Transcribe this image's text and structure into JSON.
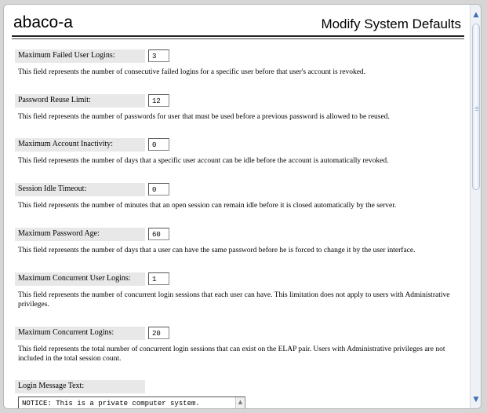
{
  "header": {
    "host": "abaco-a",
    "title": "Modify System Defaults"
  },
  "fields": [
    {
      "label": "Maximum Failed User Logins:",
      "value": "3",
      "description": "This field represents the number of consecutive failed logins for a specific user before that user's account is revoked."
    },
    {
      "label": "Password Reuse Limit:",
      "value": "12",
      "description": "This field represents the number of passwords for user that must be used before a previous password is allowed to be reused."
    },
    {
      "label": "Maximum Account Inactivity:",
      "value": "0",
      "description": "This field represents the number of days that a specific user account can be idle before the account is automatically revoked."
    },
    {
      "label": "Session Idle Timeout:",
      "value": "0",
      "description": "This field represents the number of minutes that an open session can remain idle before it is closed automatically by the server."
    },
    {
      "label": "Maximum Password Age:",
      "value": "60",
      "description": "This field represents the number of days that a user can have the same password before he is forced to change it by the user interface."
    },
    {
      "label": "Maximum Concurrent User Logins:",
      "value": "1",
      "description": "This field represents the number of concurrent login sessions that each user can have. This limitation does not apply to users with Administrative privileges."
    },
    {
      "label": "Maximum Concurrent Logins:",
      "value": "20",
      "description": "This field represents the total number of concurrent login sessions that can exist on the ELAP pair. Users with Administrative privileges are not included in the total session count."
    }
  ],
  "login_message": {
    "label": "Login Message Text:",
    "value": "NOTICE: This is a private computer system."
  },
  "icons": {
    "scroll_up": "▲",
    "scroll_down": "▼",
    "textarea_up": "▲"
  }
}
